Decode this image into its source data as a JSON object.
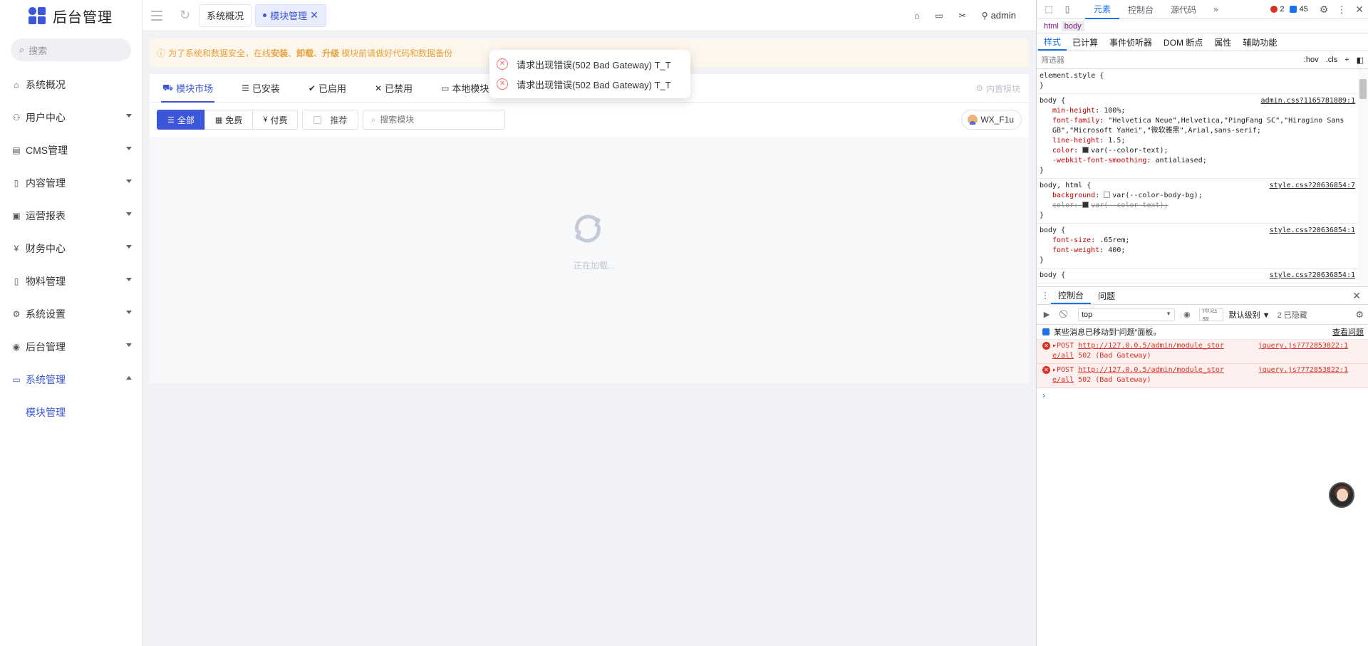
{
  "brand": {
    "title": "后台管理"
  },
  "sidebar": {
    "search_placeholder": "搜索",
    "items": [
      {
        "label": "系统概况",
        "icon": "home-icon",
        "has_arrow": false
      },
      {
        "label": "用户中心",
        "icon": "users-icon",
        "has_arrow": true
      },
      {
        "label": "CMS管理",
        "icon": "cms-icon",
        "has_arrow": true
      },
      {
        "label": "内容管理",
        "icon": "document-icon",
        "has_arrow": true
      },
      {
        "label": "运营报表",
        "icon": "image-icon",
        "has_arrow": true
      },
      {
        "label": "财务中心",
        "icon": "yen-icon",
        "has_arrow": true
      },
      {
        "label": "物料管理",
        "icon": "file-icon",
        "has_arrow": true
      },
      {
        "label": "系统设置",
        "icon": "gear-icon",
        "has_arrow": true
      },
      {
        "label": "后台管理",
        "icon": "user-circle-icon",
        "has_arrow": true
      },
      {
        "label": "系统管理",
        "icon": "code-icon",
        "has_arrow": true,
        "expanded": true
      }
    ],
    "submenu": [
      {
        "label": "模块管理"
      }
    ]
  },
  "topbar": {
    "tabs": [
      {
        "label": "系统概况",
        "active": false
      },
      {
        "label": "模块管理",
        "active": true
      }
    ],
    "user": "admin"
  },
  "notice": {
    "prefix": "为了系统和数据安全，在线",
    "kw1": "安装",
    "sep1": "、",
    "kw2": "卸载",
    "sep2": "、",
    "kw3": "升级",
    "suffix": "模块前请做好代码和数据备份"
  },
  "panel": {
    "tabs": [
      {
        "label": "模块市场",
        "icon": "cart-icon",
        "active": true
      },
      {
        "label": "已安装",
        "icon": "list-icon",
        "active": false
      },
      {
        "label": "已启用",
        "icon": "check-circle-icon",
        "active": false
      },
      {
        "label": "已禁用",
        "icon": "x-icon",
        "active": false
      },
      {
        "label": "本地模块",
        "icon": "monitor-icon",
        "active": false
      }
    ],
    "builtin_label": "内置模块",
    "filters": [
      {
        "label": "全部",
        "icon": "list-icon",
        "active": true
      },
      {
        "label": "免费",
        "icon": "gift-icon",
        "active": false
      },
      {
        "label": "付费",
        "icon": "yen-icon",
        "active": false
      }
    ],
    "recommend_label": "推荐",
    "search_placeholder": "搜索模块",
    "user_chip": "WX_F1u",
    "loading_text": "正在加载..."
  },
  "toasts": [
    {
      "text": "请求出现错误(502 Bad Gateway) T_T"
    },
    {
      "text": "请求出现错误(502 Bad Gateway) T_T"
    }
  ],
  "devtools": {
    "tabs": [
      {
        "label": "元素",
        "active": true
      },
      {
        "label": "控制台",
        "active": false
      },
      {
        "label": "源代码",
        "active": false
      }
    ],
    "more": "»",
    "error_count": "2",
    "info_count": "45",
    "breadcrumb": [
      "html",
      "body"
    ],
    "sub_tabs": [
      {
        "label": "样式",
        "active": true
      },
      {
        "label": "已计算",
        "active": false
      },
      {
        "label": "事件侦听器",
        "active": false
      },
      {
        "label": "DOM 断点",
        "active": false
      },
      {
        "label": "属性",
        "active": false
      },
      {
        "label": "辅助功能",
        "active": false
      }
    ],
    "filter_placeholder": "筛选器",
    "hov": ":hov",
    "cls": ".cls",
    "rules": {
      "r0": {
        "selector": "element.style {",
        "close": "}"
      },
      "r1": {
        "selector": "body {",
        "source": "admin.css?1165781889:1",
        "close": "}",
        "d1p": "min-height",
        "d1v": "100%;",
        "d2p": "font-family",
        "d2v": "\"Helvetica Neue\",Helvetica,\"PingFang SC\",\"Hiragino Sans GB\",\"Microsoft YaHei\",\"微软雅黑\",Arial,sans-serif;",
        "d3p": "line-height",
        "d3v": "1.5;",
        "d4p": "color",
        "d4v": "var(--color-text);",
        "d5p": "-webkit-font-smoothing",
        "d5v": "antialiased;"
      },
      "r2": {
        "selector": "body, html {",
        "source": "style.css?20636854:7",
        "close": "}",
        "d1p": "background",
        "d1v": "var(--color-body-bg);",
        "d2p": "color",
        "d2v": "var(--color-text);"
      },
      "r3": {
        "selector": "body {",
        "source": "style.css?20636854:1",
        "close": "}",
        "d1p": "font-size",
        "d1v": ".65rem;",
        "d2p": "font-weight",
        "d2v": "400;"
      },
      "r4": {
        "selector": "body {",
        "source": "style.css?20636854:1"
      }
    },
    "drawer_tabs": [
      {
        "label": "控制台",
        "active": true
      },
      {
        "label": "问题",
        "active": false
      }
    ],
    "console": {
      "context": "top",
      "filter": "筛选器",
      "levels": "默认级别 ▼",
      "hidden": "2 已隐藏",
      "moved_msg": "某些消息已移动到“问题”面板。",
      "view_issues": "查看问题",
      "errors": [
        {
          "method": "▸POST",
          "url1": "http://127.0.0.5/admin/module_stor",
          "url2": "e/all",
          "status": "502 (Bad Gateway)",
          "source": "jquery.js?772853822:1"
        },
        {
          "method": "▸POST",
          "url1": "http://127.0.0.5/admin/module_stor",
          "url2": "e/all",
          "status": "502 (Bad Gateway)",
          "source": "jquery.js?772853822:1"
        }
      ],
      "prompt": "›"
    }
  },
  "colors": {
    "accent": "#3b56d8",
    "warning": "#e6a23c",
    "error": "#f56c6c"
  }
}
